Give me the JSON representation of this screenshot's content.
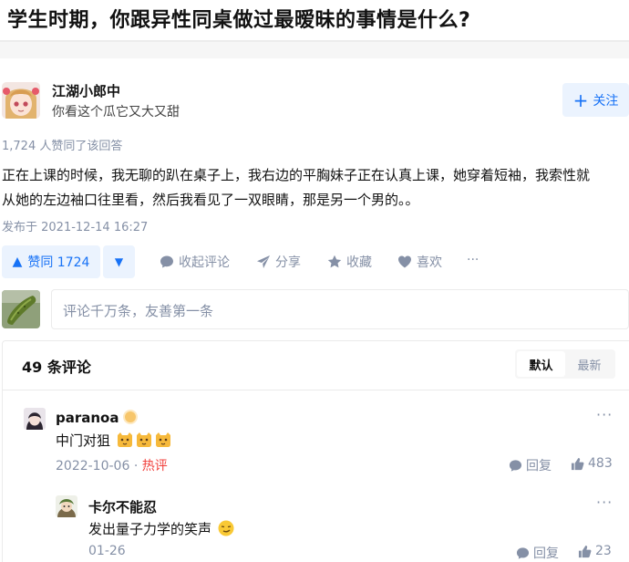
{
  "question": {
    "title": "学生时期，你跟异性同桌做过最暧昧的事情是什么?"
  },
  "author": {
    "name": "江湖小郎中",
    "bio": "你看这个瓜它又大又甜",
    "follow_label": "关注"
  },
  "answer": {
    "upvote_summary": "1,724 人赞同了该回答",
    "lines": [
      "正在上课的时候，我无聊的趴在桌子上，我右边的平胸妹子正在认真上课，她穿着短袖，我索性就",
      "从她的左边袖口往里看，然后我看见了一双眼睛，那是另一个男的。。"
    ],
    "publish_time": "发布于 2021-12-14 16:27"
  },
  "actions": {
    "upvote_label": "赞同 1724",
    "collapse_comments": "收起评论",
    "share": "分享",
    "favorite": "收藏",
    "like": "喜欢",
    "more": "···"
  },
  "comment_box": {
    "placeholder": "评论千万条，友善第一条"
  },
  "comments_panel": {
    "count_label": "49 条评论",
    "sort_default": "默认",
    "sort_latest": "最新",
    "items": [
      {
        "author": "paranoa",
        "text": "中门对狙",
        "date": "2022-10-06",
        "sep": "·",
        "hot": "热评",
        "reply": "回复",
        "likes": "483",
        "more": "···"
      },
      {
        "author": "卡尔不能忍",
        "text": "发出量子力学的笑声",
        "date": "01-26",
        "reply": "回复",
        "likes": "23",
        "more": "···"
      }
    ]
  },
  "colors": {
    "accent": "#1772f6",
    "accent_bg": "#ebf3fe",
    "muted": "#8590a6",
    "hot": "#f1403c"
  }
}
